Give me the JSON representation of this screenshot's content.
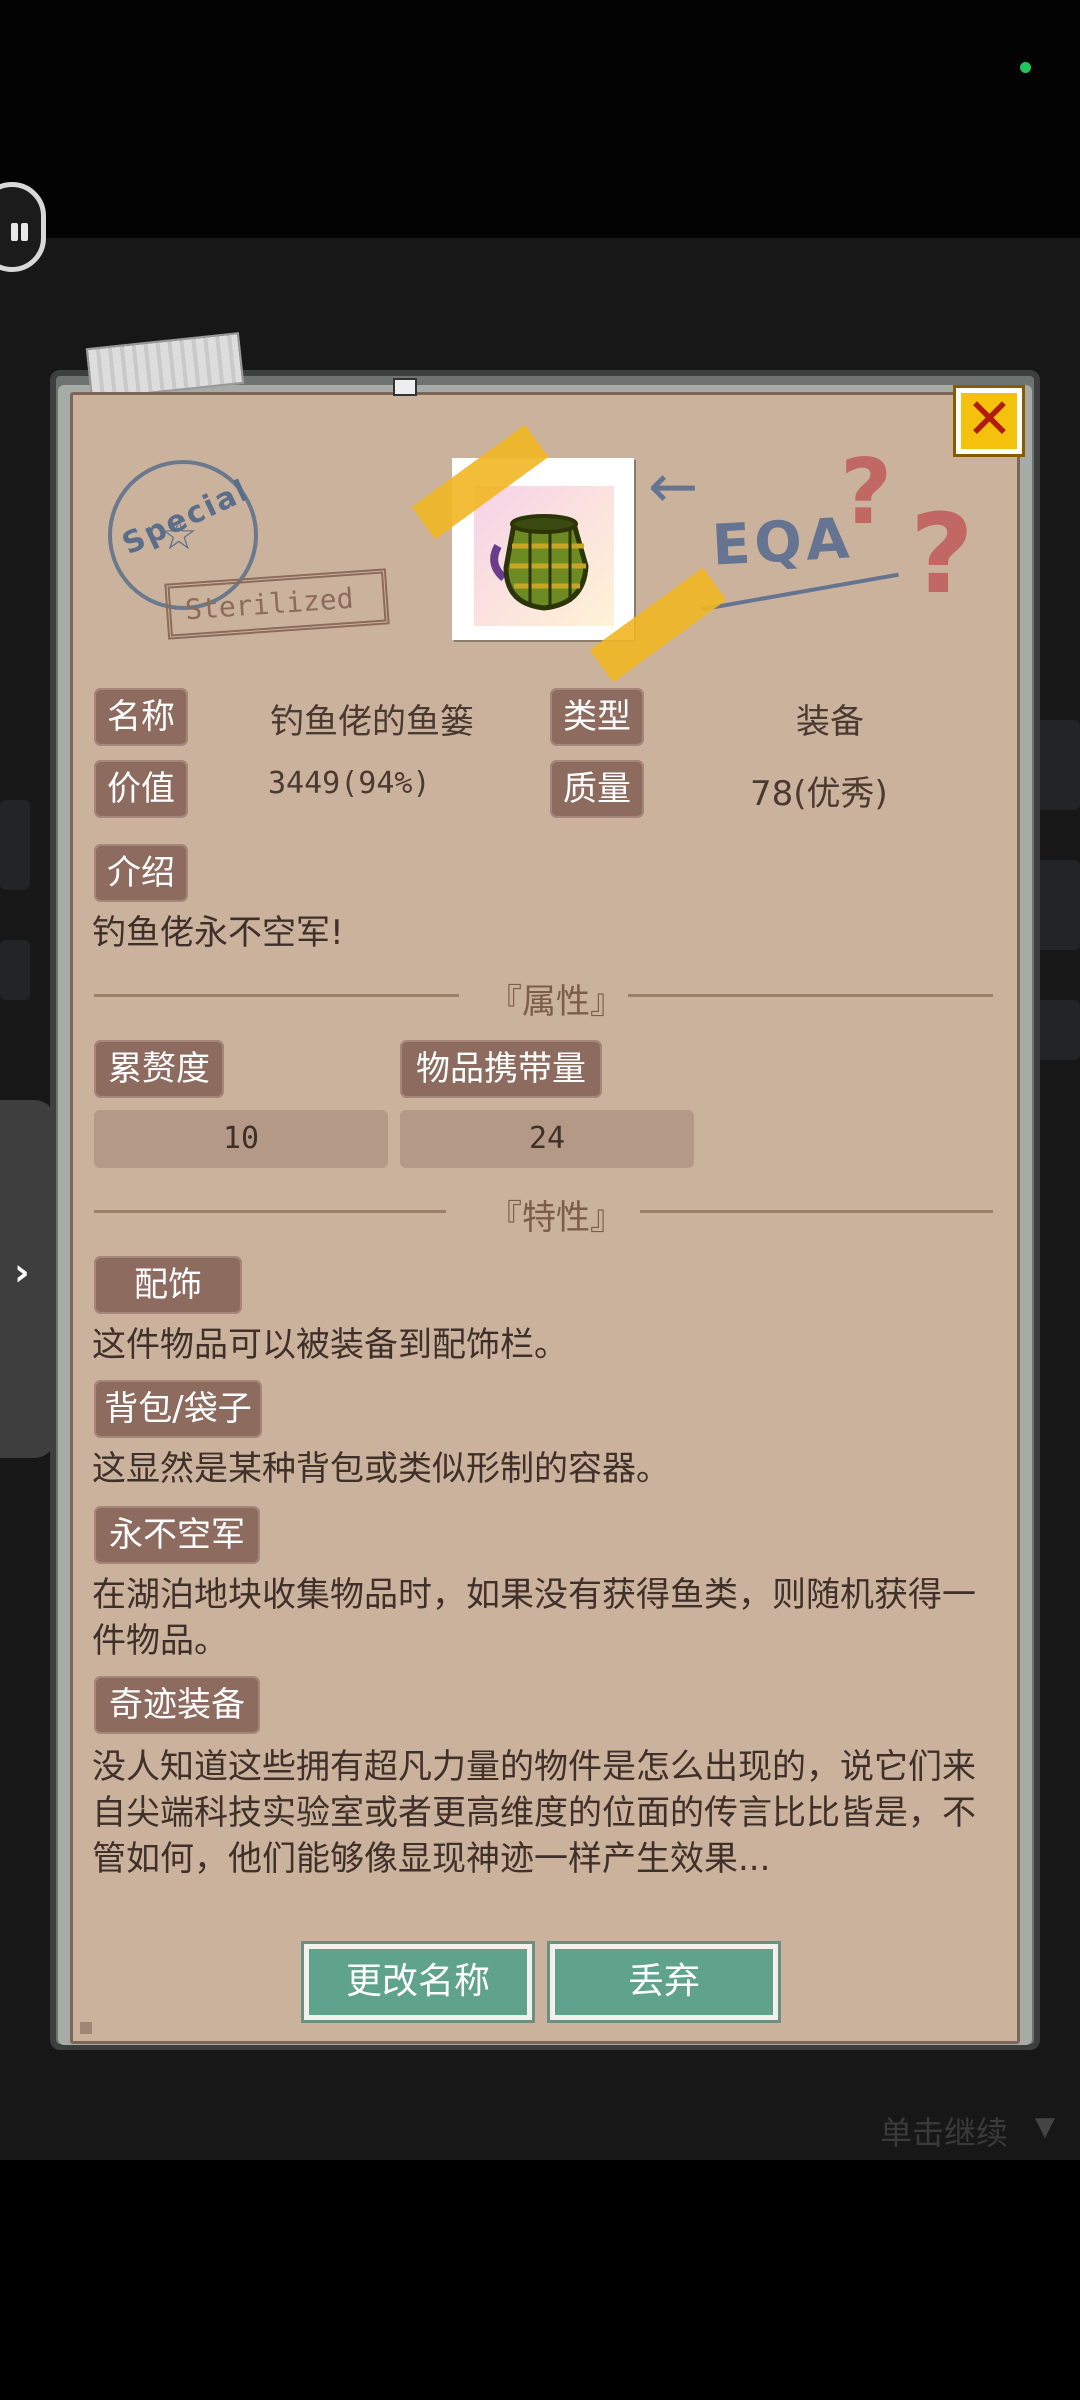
{
  "dialog": {
    "name_label": "名称",
    "name_value": "钓鱼佬的鱼篓",
    "type_label": "类型",
    "type_value": "装备",
    "worth_label": "价值",
    "worth_value": "3449(94%)",
    "quality_label": "质量",
    "quality_value": "78(优秀)",
    "intro_label": "介绍",
    "intro_text": "钓鱼佬永不空军!",
    "attributes_heading": "『属性』",
    "fatigue_label": "累赘度",
    "fatigue_value": "10",
    "carry_label": "物品携带量",
    "carry_value": "24",
    "traits_heading": "『特性』",
    "traits": [
      {
        "label": "配饰",
        "text": "这件物品可以被装备到配饰栏。"
      },
      {
        "label": "背包/袋子",
        "text": "这显然是某种背包或类似形制的容器。"
      },
      {
        "label": "永不空军",
        "text": "在湖泊地块收集物品时，如果没有获得鱼类，则随机获得一件物品。"
      },
      {
        "label": "奇迹装备",
        "text": "没人知道这些拥有超凡力量的物件是怎么出现的，说它们来自尖端科技实验室或者更高维度的位面的传言比比皆是，不管如何，他们能够像显现神迹一样产生效果..."
      }
    ],
    "rename_button": "更改名称",
    "discard_button": "丢弃"
  },
  "decor": {
    "stamp_special": "Special",
    "stamp_sterilized": "Sterilized",
    "eqa_text": "EQA"
  },
  "hud": {
    "tap_to_continue": "单击继续"
  },
  "icons": [
    "pause-icon",
    "close-icon",
    "chevron-right-icon",
    "basket-icon",
    "triangle-down-icon"
  ],
  "colors": {
    "panel": "#cbb29d",
    "label_bg": "#8e6b5f",
    "button": "#5fa38c",
    "close": "#f4c20d"
  }
}
